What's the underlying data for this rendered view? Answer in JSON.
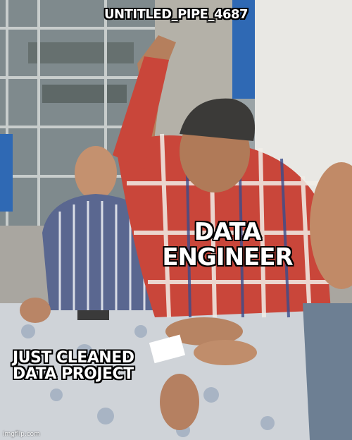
{
  "meme": {
    "top_caption": "UNTITLED_PIPE_4687",
    "middle_caption": "DATA\nENGINEER",
    "left_caption": "JUST CLEANED\nDATA PROJECT",
    "watermark": "imgflip.com"
  }
}
